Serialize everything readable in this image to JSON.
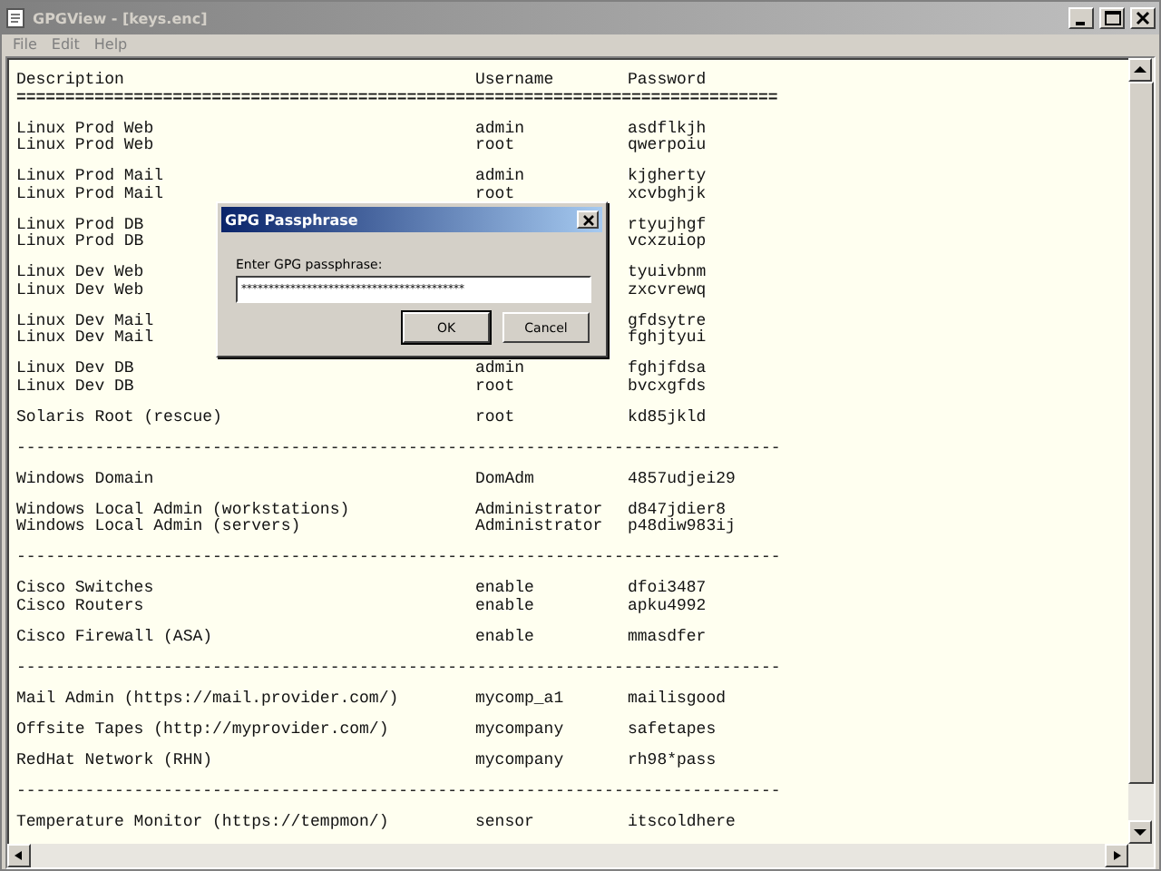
{
  "window": {
    "title": "GPGView - [keys.enc]",
    "active": false
  },
  "menu": [
    {
      "label": "File"
    },
    {
      "label": "Edit"
    },
    {
      "label": "Help"
    }
  ],
  "header": {
    "description": "Description",
    "username": "Username",
    "password": "Password"
  },
  "lines": [
    {
      "kind": "rule",
      "text": "=============================================================================="
    },
    {
      "kind": "gap"
    },
    {
      "kind": "entry",
      "description": "Linux Prod Web",
      "username": "admin",
      "password": "asdflkjh"
    },
    {
      "kind": "entry",
      "description": "Linux Prod Web",
      "username": "root",
      "password": "qwerpoiu"
    },
    {
      "kind": "gap"
    },
    {
      "kind": "entry",
      "description": "Linux Prod Mail",
      "username": "admin",
      "password": "kjgherty"
    },
    {
      "kind": "entry",
      "description": "Linux Prod Mail",
      "username": "root",
      "password": "xcvbghjk"
    },
    {
      "kind": "gap"
    },
    {
      "kind": "entry",
      "description": "Linux Prod DB",
      "password": "rtyujhgf"
    },
    {
      "kind": "entry",
      "description": "Linux Prod DB",
      "password": "vcxzuiop"
    },
    {
      "kind": "gap"
    },
    {
      "kind": "entry",
      "description": "Linux Dev Web",
      "password": "tyuivbnm"
    },
    {
      "kind": "entry",
      "description": "Linux Dev Web",
      "password": "zxcvrewq"
    },
    {
      "kind": "gap"
    },
    {
      "kind": "entry",
      "description": "Linux Dev Mail",
      "password": "gfdsytre"
    },
    {
      "kind": "entry",
      "description": "Linux Dev Mail",
      "password": "fghjtyui"
    },
    {
      "kind": "gap"
    },
    {
      "kind": "entry",
      "description": "Linux Dev DB",
      "username": "admin",
      "password": "fghjfdsa"
    },
    {
      "kind": "entry",
      "description": "Linux Dev DB",
      "username": "root",
      "password": "bvcxgfds"
    },
    {
      "kind": "gap"
    },
    {
      "kind": "entry",
      "description": "Solaris Root (rescue)",
      "username": "root",
      "password": "kd85jkld"
    },
    {
      "kind": "gap"
    },
    {
      "kind": "rule",
      "text": "------------------------------------------------------------------------------"
    },
    {
      "kind": "gap"
    },
    {
      "kind": "entry",
      "description": "Windows Domain",
      "username": "DomAdm",
      "password": "4857udjei29"
    },
    {
      "kind": "gap"
    },
    {
      "kind": "entry",
      "description": "Windows Local Admin (workstations)",
      "username": "Administrator",
      "password": "d847jdier8"
    },
    {
      "kind": "entry",
      "description": "Windows Local Admin (servers)",
      "username": "Administrator",
      "password": "p48diw983ij"
    },
    {
      "kind": "gap"
    },
    {
      "kind": "rule",
      "text": "------------------------------------------------------------------------------"
    },
    {
      "kind": "gap"
    },
    {
      "kind": "entry",
      "description": "Cisco Switches",
      "username": "enable",
      "password": "dfoi3487"
    },
    {
      "kind": "entry",
      "description": "Cisco Routers",
      "username": "enable",
      "password": "apku4992"
    },
    {
      "kind": "gap"
    },
    {
      "kind": "entry",
      "description": "Cisco Firewall (ASA)",
      "username": "enable",
      "password": "mmasdfer"
    },
    {
      "kind": "gap"
    },
    {
      "kind": "rule",
      "text": "------------------------------------------------------------------------------"
    },
    {
      "kind": "gap"
    },
    {
      "kind": "entry",
      "description": "Mail Admin (https://mail.provider.com/)",
      "username": "mycomp_a1",
      "password": "mailisgood"
    },
    {
      "kind": "gap"
    },
    {
      "kind": "entry",
      "description": "Offsite Tapes (http://myprovider.com/)",
      "username": "mycompany",
      "password": "safetapes"
    },
    {
      "kind": "gap"
    },
    {
      "kind": "entry",
      "description": "RedHat Network (RHN)",
      "username": "mycompany",
      "password": "rh98*pass"
    },
    {
      "kind": "gap"
    },
    {
      "kind": "rule",
      "text": "------------------------------------------------------------------------------"
    },
    {
      "kind": "gap"
    },
    {
      "kind": "entry",
      "description": "Temperature Monitor (https://tempmon/)",
      "username": "sensor",
      "password": "itscoldhere"
    }
  ],
  "dialog": {
    "title": "GPG Passphrase",
    "label": "Enter GPG passphrase:",
    "value": "*****************************************",
    "buttons": [
      {
        "label": "OK",
        "default": true
      },
      {
        "label": "Cancel",
        "default": false
      }
    ]
  }
}
